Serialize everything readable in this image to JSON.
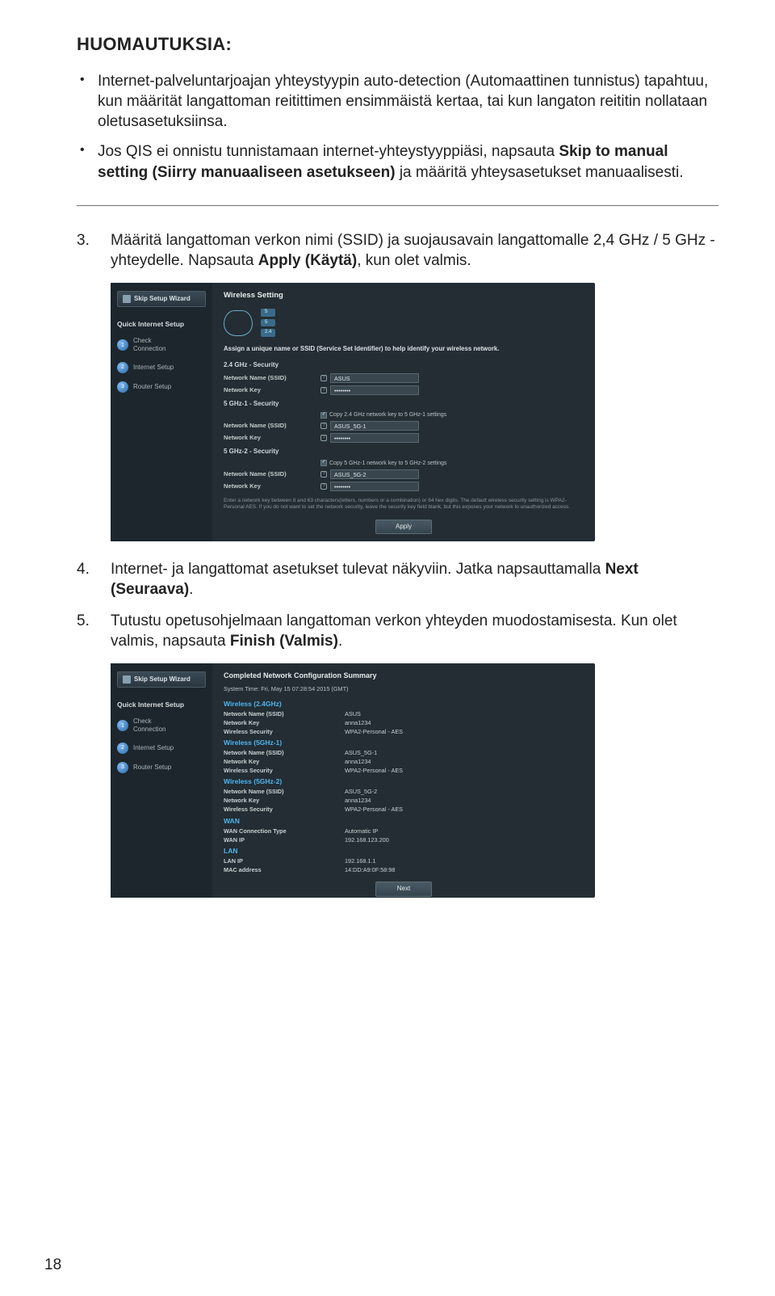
{
  "heading": "HUOMAUTUKSIA:",
  "notes": [
    {
      "pre": "Internet-palveluntarjoajan yhteystyypin auto-detection (Automaattinen tunnistus) tapahtuu, kun määrität langattoman reitittimen ensimmäistä kertaa, tai kun langaton reititin nollataan oletusasetuksiinsa."
    },
    {
      "pre2a": "Jos QIS ei onnistu tunnistamaan internet-yhteystyyppiäsi, napsauta ",
      "bold": "Skip to manual setting (Siirry manuaaliseen asetukseen)",
      "post": " ja määritä yhteysasetukset manuaalisesti."
    }
  ],
  "steps": {
    "s3": {
      "num": "3.",
      "a": "Määritä langattoman verkon nimi (SSID) ja suojausavain langattomalle 2,4 GHz / 5 GHz -yhteydelle. Napsauta ",
      "bold": "Apply (Käytä)",
      "b": ", kun olet valmis."
    },
    "s4": {
      "num": "4.",
      "a": "Internet- ja langattomat asetukset tulevat näkyviin. Jatka napsauttamalla ",
      "bold": "Next (Seuraava)",
      "b": "."
    },
    "s5": {
      "num": "5.",
      "a": "Tutustu opetusohjelmaan langattoman verkon yhteyden muodostamisesta. Kun olet valmis, napsauta ",
      "bold": "Finish (Valmis)",
      "b": "."
    }
  },
  "router": {
    "side": {
      "skip": "Skip Setup Wizard",
      "qis": "Quick Internet Setup",
      "step1a": "Check",
      "step1b": "Connection",
      "step2": "Internet Setup",
      "step3": "Router Setup"
    },
    "wireless": {
      "title": "Wireless Setting",
      "chan": {
        "a": "5",
        "b": "5",
        "c": "2.4"
      },
      "desc": "Assign a unique name or SSID (Service Set Identifier) to help identify your wireless network.",
      "sec24": "2.4 GHz - Security",
      "sec51": "5 GHz-1 - Security",
      "sec52": "5 GHz-2 - Security",
      "nn": "Network Name (SSID)",
      "nk": "Network Key",
      "val24": "ASUS",
      "val51": "ASUS_5G-1",
      "val52": "ASUS_5G-2",
      "pw": "••••••••",
      "copy51": "Copy 2.4 GHz network key to 5 GHz-1 settings",
      "copy52": "Copy 5 GHz-1 network key to 5 GHz-2 settings",
      "fine": "Enter a network key between 8 and 63 characters(letters, numbers or a combination) or 64 hex digits. The default wireless security setting is WPA2-Personal AES. If you do not want to set the network security, leave the security key field blank, but this exposes your network to unauthorized access.",
      "apply": "Apply"
    },
    "summary": {
      "title": "Completed Network Configuration Summary",
      "time": "System Time: Fri, May 15 07:28:54 2015 (GMT)",
      "w24": "Wireless (2.4GHz)",
      "w51": "Wireless (5GHz-1)",
      "w52": "Wireless (5GHz-2)",
      "nn": "Network Name (SSID)",
      "nk": "Network Key",
      "ws": "Wireless Security",
      "ssid24": "ASUS",
      "ssid51": "ASUS_5G-1",
      "ssid52": "ASUS_5G-2",
      "key": "anna1234",
      "sec": "WPA2-Personal - AES",
      "wan": "WAN",
      "wanct": "WAN Connection Type",
      "wanctv": "Automatic IP",
      "wanip": "WAN IP",
      "wanipv": "192.168.123.200",
      "lan": "LAN",
      "lanip": "LAN IP",
      "lanipv": "192.168.1.1",
      "mac": "MAC address",
      "macv": "14:DD:A9:0F:58:98",
      "next": "Next"
    }
  },
  "pageNumber": "18"
}
